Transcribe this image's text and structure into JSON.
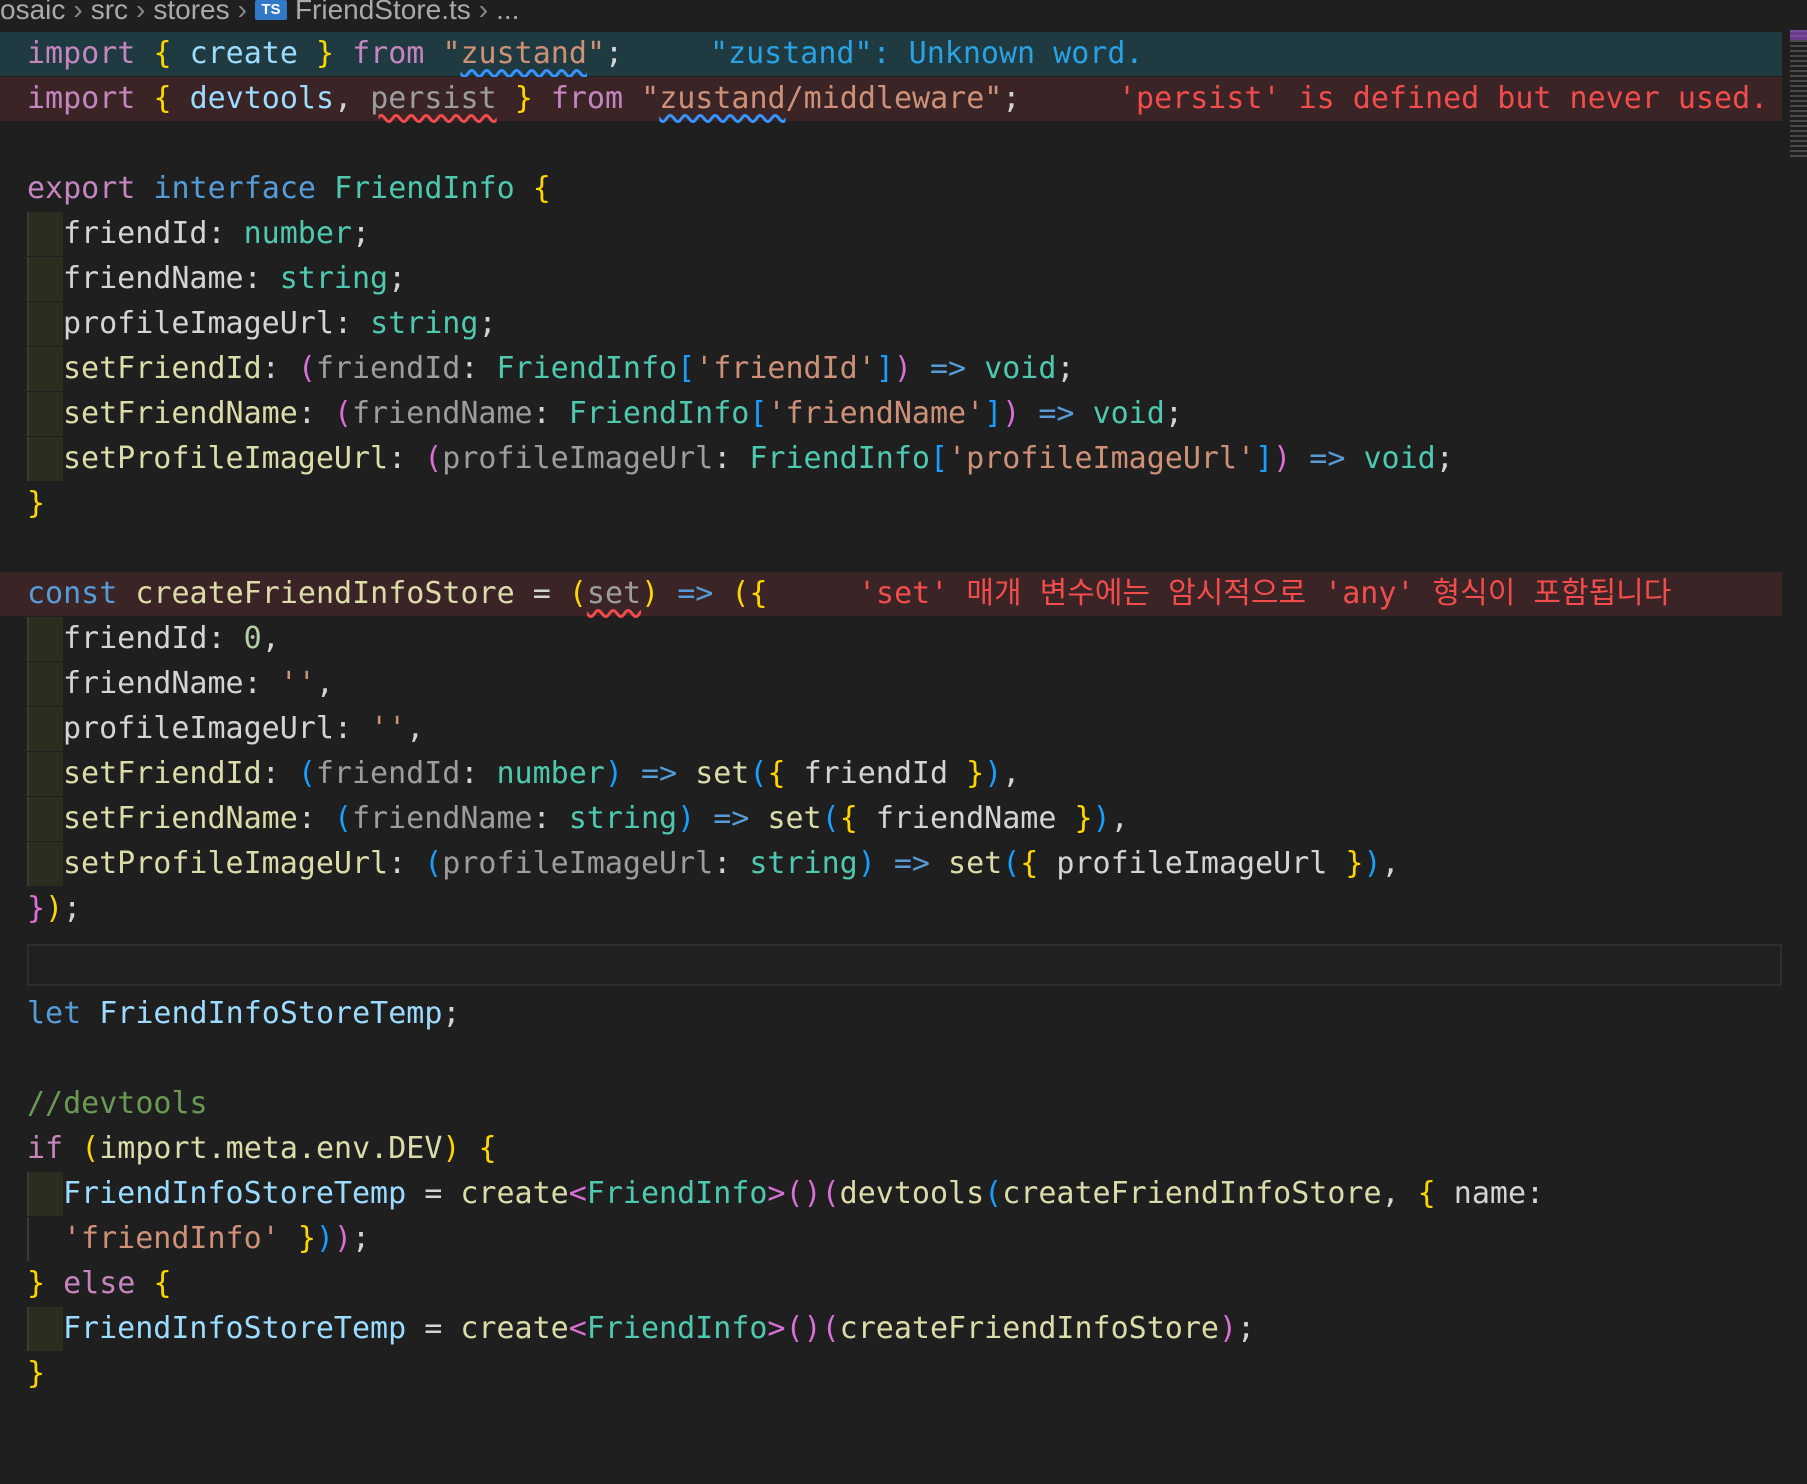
{
  "breadcrumb": {
    "items": [
      "osaic",
      "src",
      "stores",
      "FriendStore.ts",
      "..."
    ],
    "file_icon": "TS"
  },
  "diagnostics": {
    "unknown_word": "\"zustand\": Unknown word.",
    "unused_persist": "'persist' is defined but never used.",
    "implicit_any": "'set' 매개 변수에는 암시적으로 'any' 형식이 포함됩니다"
  },
  "code": {
    "l1": {
      "kw": "import",
      "a": "{",
      "create": "create",
      "b": "}",
      "from": "from",
      "str_open": "\"",
      "str_word": "zustand",
      "str_close": "\"",
      "semi": ";"
    },
    "l2": {
      "kw": "import",
      "a": "{",
      "devtools": "devtools",
      "comma": ",",
      "persist": "persist",
      "b": "}",
      "from": "from",
      "str_open": "\"",
      "str_word": "zustand",
      "str_rest": "/middleware\"",
      "semi": ";"
    },
    "l4": {
      "export": "export",
      "interface": "interface",
      "name": "FriendInfo",
      "brace": "{"
    },
    "l5": {
      "prop": "friendId",
      "colon": ":",
      "type": "number",
      "semi": ";"
    },
    "l6": {
      "prop": "friendName",
      "colon": ":",
      "type": "string",
      "semi": ";"
    },
    "l7": {
      "prop": "profileImageUrl",
      "colon": ":",
      "type": "string",
      "semi": ";"
    },
    "l8": {
      "prop": "setFriendId",
      "colon": ":",
      "p_open": "(",
      "param": "friendId",
      "colon2": ":",
      "type": "FriendInfo",
      "idx_open": "[",
      "key": "'friendId'",
      "idx_close": "]",
      "p_close": ")",
      "arrow": "=>",
      "ret": "void",
      "semi": ";"
    },
    "l9": {
      "prop": "setFriendName",
      "colon": ":",
      "p_open": "(",
      "param": "friendName",
      "colon2": ":",
      "type": "FriendInfo",
      "idx_open": "[",
      "key": "'friendName'",
      "idx_close": "]",
      "p_close": ")",
      "arrow": "=>",
      "ret": "void",
      "semi": ";"
    },
    "l10": {
      "prop": "setProfileImageUrl",
      "colon": ":",
      "p_open": "(",
      "param": "profileImageUrl",
      "colon2": ":",
      "type": "FriendInfo",
      "idx_open": "[",
      "key": "'profileImageUrl'",
      "idx_close": "]",
      "p_close": ")",
      "arrow": "=>",
      "ret": "void",
      "semi": ";"
    },
    "l11": {
      "brace": "}"
    },
    "l13": {
      "const": "const",
      "name": "createFriendInfoStore",
      "eq": "=",
      "p_open": "(",
      "param": "set",
      "p_close": ")",
      "arrow": "=>",
      "open": "({"
    },
    "l14": {
      "prop": "friendId",
      "colon": ":",
      "num": "0",
      "comma": ","
    },
    "l15": {
      "prop": "friendName",
      "colon": ":",
      "str": "''",
      "comma": ","
    },
    "l16": {
      "prop": "profileImageUrl",
      "colon": ":",
      "str": "''",
      "comma": ","
    },
    "l17": {
      "prop": "setFriendId",
      "colon": ":",
      "p_open": "(",
      "param": "friendId",
      "colon2": ":",
      "type": "number",
      "p_close": ")",
      "arrow": "=>",
      "fn": "set",
      "call_open": "(",
      "obj_open": "{",
      "arg": "friendId",
      "obj_close": "}",
      "call_close": ")",
      "comma": ","
    },
    "l18": {
      "prop": "setFriendName",
      "colon": ":",
      "p_open": "(",
      "param": "friendName",
      "colon2": ":",
      "type": "string",
      "p_close": ")",
      "arrow": "=>",
      "fn": "set",
      "call_open": "(",
      "obj_open": "{",
      "arg": "friendName",
      "obj_close": "}",
      "call_close": ")",
      "comma": ","
    },
    "l19": {
      "prop": "setProfileImageUrl",
      "colon": ":",
      "p_open": "(",
      "param": "profileImageUrl",
      "colon2": ":",
      "type": "string",
      "p_close": ")",
      "arrow": "=>",
      "fn": "set",
      "call_open": "(",
      "obj_open": "{",
      "arg": "profileImageUrl",
      "obj_close": "}",
      "call_close": ")",
      "comma": ","
    },
    "l20": {
      "obj_close": "}",
      "p_close": ")",
      "semi": ";"
    },
    "l22": {
      "let": "let",
      "name": "FriendInfoStoreTemp",
      "semi": ";"
    },
    "l24": {
      "comment": "//devtools"
    },
    "l25": {
      "if": "if",
      "p_open": "(",
      "expr": "import.meta.env.DEV",
      "p_close": ")",
      "brace": "{"
    },
    "l26": {
      "name": "FriendInfoStoreTemp",
      "eq": "=",
      "fn": "create",
      "lt": "<",
      "type": "FriendInfo",
      "gt": ">",
      "call1": "()",
      "p_open": "(",
      "devtools": "devtools",
      "p2_open": "(",
      "arg": "createFriendInfoStore",
      "comma": ",",
      "obj_open": "{",
      "key": "name",
      "colon": ":"
    },
    "l27": {
      "str": "'friendInfo'",
      "obj_close": "}",
      "p2_close": ")",
      "p_close": ")",
      "semi": ";"
    },
    "l28": {
      "brace_close": "}",
      "else": "else",
      "brace": "{"
    },
    "l29": {
      "name": "FriendInfoStoreTemp",
      "eq": "=",
      "fn": "create",
      "lt": "<",
      "type": "FriendInfo",
      "gt": ">",
      "call1": "()",
      "p_open": "(",
      "arg": "createFriendInfoStore",
      "p_close": ")",
      "semi": ";"
    },
    "l30": {
      "brace": "}"
    }
  }
}
